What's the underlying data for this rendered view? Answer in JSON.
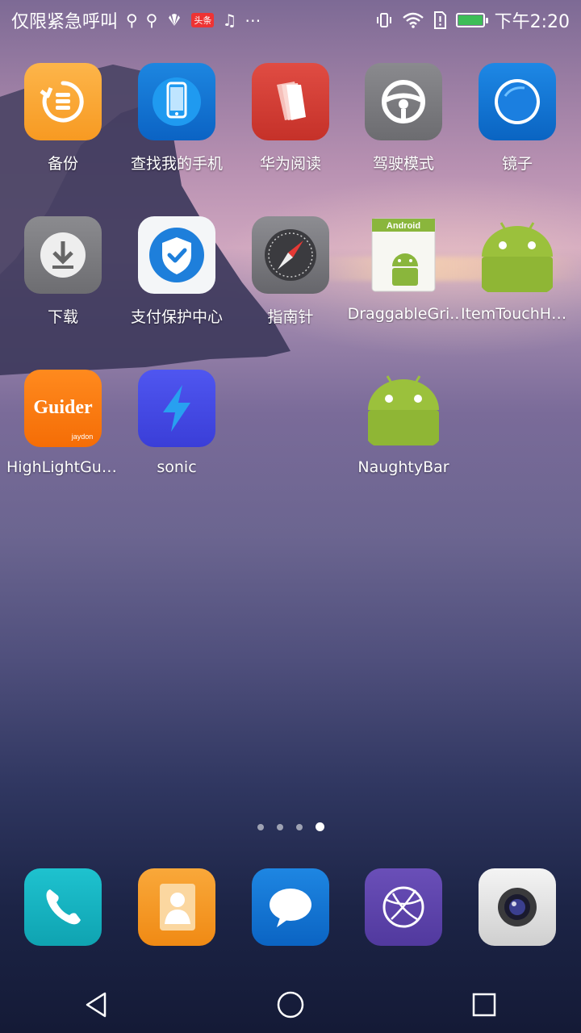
{
  "status_bar": {
    "carrier_text": "仅限紧急呼叫",
    "notif_badge": "头条",
    "more_icon": "⋯",
    "time": "下午2:20"
  },
  "apps": [
    {
      "label": "备份",
      "icon": "backup-icon"
    },
    {
      "label": "查找我的手机",
      "icon": "find-phone-icon"
    },
    {
      "label": "华为阅读",
      "icon": "reader-icon"
    },
    {
      "label": "驾驶模式",
      "icon": "steering-wheel-icon"
    },
    {
      "label": "镜子",
      "icon": "mirror-icon"
    },
    {
      "label": "下载",
      "icon": "download-icon"
    },
    {
      "label": "支付保护中心",
      "icon": "shield-check-icon"
    },
    {
      "label": "指南针",
      "icon": "compass-icon"
    },
    {
      "label": "DraggableGri..",
      "icon": "android-app-icon",
      "icon_text": "Android"
    },
    {
      "label": "ItemTouchHel..",
      "icon": "android-icon"
    },
    {
      "label": "HighLightGuid..",
      "icon": "guider-icon",
      "icon_text": "Guider",
      "icon_subtext": "jaydon"
    },
    {
      "label": "sonic",
      "icon": "lightning-icon"
    },
    {
      "label": "NaughtyBar",
      "icon": "android-icon"
    }
  ],
  "pager": {
    "pages": 4,
    "active_index": 3
  },
  "dock": [
    {
      "icon": "phone-icon"
    },
    {
      "icon": "contacts-icon"
    },
    {
      "icon": "messages-icon"
    },
    {
      "icon": "browser-icon"
    },
    {
      "icon": "camera-icon"
    }
  ],
  "navbar": [
    {
      "icon": "back-icon"
    },
    {
      "icon": "home-icon"
    },
    {
      "icon": "recents-icon"
    }
  ]
}
